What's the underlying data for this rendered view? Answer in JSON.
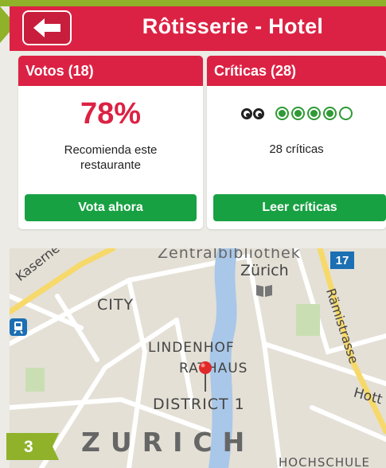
{
  "header": {
    "title": "Rôtisserie - Hotel"
  },
  "votes_card": {
    "heading": "Votos (18)",
    "percent": "78%",
    "recommend_text": "Recomienda este restaurante",
    "button_label": "Vota ahora"
  },
  "reviews_card": {
    "heading": "Críticas (28)",
    "rating_bubbles": 5,
    "rating_filled": 4,
    "count_text": "28 críticas",
    "button_label": "Leer críticas"
  },
  "map": {
    "labels": {
      "zentral": "Zentralbibliothek",
      "zurich_small": "Zürich",
      "kaserne": "Kaserne",
      "city": "CITY",
      "ramistrasse": "Rämistrasse",
      "lindenhof": "LINDENHOF",
      "rathaus": "RATHAUS",
      "district": "DISTRICT 1",
      "zurich_big": "ZURICH",
      "hott": "Hott",
      "hochschule": "HOCHSCHULE"
    },
    "tram_badge": "17"
  },
  "step_badge": "3",
  "colors": {
    "accent_red": "#dc2244",
    "button_green": "#18a142",
    "olive": "#8fb22a",
    "river": "#a9c7e8"
  }
}
